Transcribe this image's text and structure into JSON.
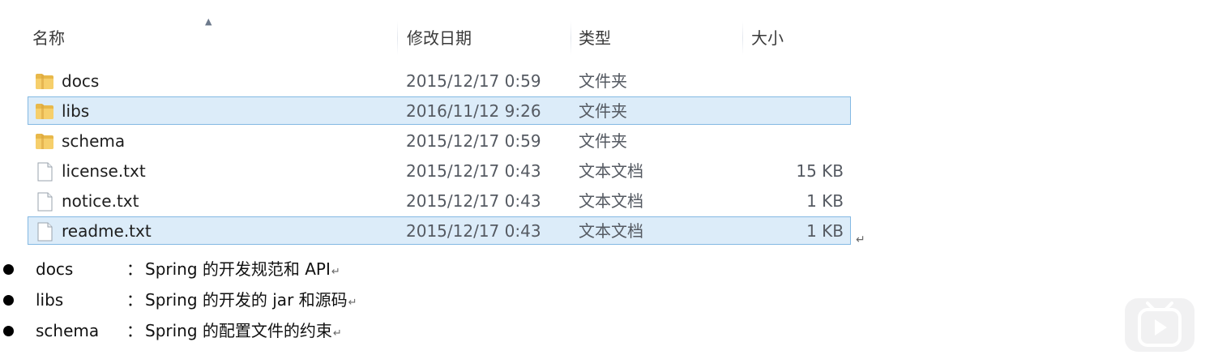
{
  "columns": {
    "name": "名称",
    "date": "修改日期",
    "type": "类型",
    "size": "大小"
  },
  "files": [
    {
      "name": "docs",
      "date": "2015/12/17 0:59",
      "type": "文件夹",
      "size": "",
      "icon": "folder-icon",
      "selected": false
    },
    {
      "name": "libs",
      "date": "2016/11/12 9:26",
      "type": "文件夹",
      "size": "",
      "icon": "folder-icon",
      "selected": true
    },
    {
      "name": "schema",
      "date": "2015/12/17 0:59",
      "type": "文件夹",
      "size": "",
      "icon": "folder-icon",
      "selected": false
    },
    {
      "name": "license.txt",
      "date": "2015/12/17 0:43",
      "type": "文本文档",
      "size": "15 KB",
      "icon": "text-file-icon",
      "selected": false
    },
    {
      "name": "notice.txt",
      "date": "2015/12/17 0:43",
      "type": "文本文档",
      "size": "1 KB",
      "icon": "text-file-icon",
      "selected": false
    },
    {
      "name": "readme.txt",
      "date": "2015/12/17 0:43",
      "type": "文本文档",
      "size": "1 KB",
      "icon": "text-file-icon",
      "selected": true
    }
  ],
  "notes": [
    {
      "term": "docs",
      "sep": "：",
      "desc": "Spring 的开发规范和 API"
    },
    {
      "term": "libs",
      "sep": "：",
      "desc": "Spring 的开发的 jar 和源码"
    },
    {
      "term": "schema",
      "sep": "：",
      "desc": "Spring 的配置文件的约束"
    }
  ],
  "colors": {
    "selection_fill": "#dcecf9",
    "selection_border": "#84b9e3",
    "folder": "#e8b84a"
  },
  "icons": {
    "sort": "sort-up-icon",
    "play": "play-icon"
  }
}
